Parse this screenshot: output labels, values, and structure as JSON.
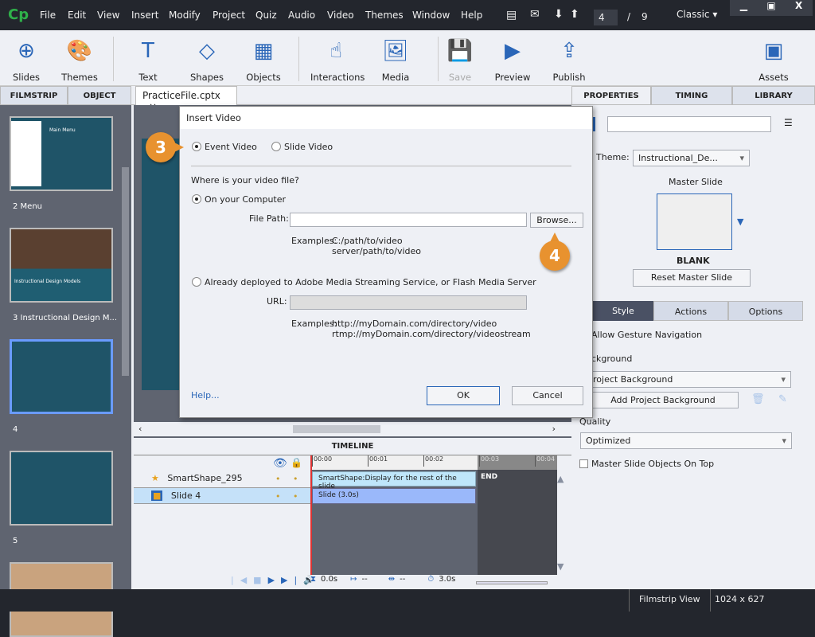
{
  "app": {
    "logo": "Cp",
    "menu": [
      "File",
      "Edit",
      "View",
      "Insert",
      "Modify",
      "Project",
      "Quiz",
      "Audio",
      "Video",
      "Themes",
      "Window",
      "Help"
    ],
    "current_slide": "4",
    "slide_sep": "/",
    "total_slides": "9",
    "workspace": "Classic"
  },
  "toolbar": {
    "items": [
      {
        "label": "Slides",
        "icon": "plus-circle-icon"
      },
      {
        "label": "Themes",
        "icon": "palette-icon"
      },
      {
        "label": "Text",
        "icon": "text-icon"
      },
      {
        "label": "Shapes",
        "icon": "shapes-icon"
      },
      {
        "label": "Objects",
        "icon": "objects-icon"
      },
      {
        "label": "Interactions",
        "icon": "hand-pointer-icon"
      },
      {
        "label": "Media",
        "icon": "image-icon"
      },
      {
        "label": "Save",
        "icon": "floppy-icon"
      },
      {
        "label": "Preview",
        "icon": "play-circle-icon"
      },
      {
        "label": "Publish",
        "icon": "publish-icon"
      },
      {
        "label": "Assets",
        "icon": "assets-icon"
      }
    ]
  },
  "panels": {
    "filmstrip": "FILMSTRIP",
    "object_state": "OBJECT STATE",
    "doc_tab": "PracticeFile.cptx",
    "properties": "PROPERTIES",
    "timing": "TIMING",
    "library": "LIBRARY"
  },
  "filmstrip": {
    "slides": [
      {
        "label": "2 Menu",
        "title": "Main Menu"
      },
      {
        "label": "3 Instructional Design M...",
        "title": "Instructional Design Models"
      },
      {
        "label": "4"
      },
      {
        "label": "5"
      }
    ]
  },
  "dialog": {
    "title": "Insert Video",
    "event_video": "Event Video",
    "slide_video": "Slide Video",
    "question": "Where is your video file?",
    "on_computer": "On your Computer",
    "file_path_label": "File Path:",
    "file_path_value": "",
    "browse": "Browse...",
    "examples_label": "Examples:",
    "file_ex1": "C:/path/to/video",
    "file_ex2": "server/path/to/video",
    "deployed": "Already deployed to Adobe Media Streaming Service, or Flash Media Server",
    "url_label": "URL:",
    "url_ex1": "http://myDomain.com/directory/video",
    "url_ex2": "rtmp://myDomain.com/directory/videostream",
    "help": "Help...",
    "ok": "OK",
    "cancel": "Cancel"
  },
  "callouts": {
    "step3": "3",
    "step4": "4"
  },
  "timeline": {
    "title": "TIMELINE",
    "ticks": [
      "00:00",
      "00:01",
      "00:02",
      "00:03",
      "00:04"
    ],
    "rows": [
      {
        "name": "SmartShape_295",
        "bar": "SmartShape:Display for the rest of the slide"
      },
      {
        "name": "Slide 4",
        "bar": "Slide (3.0s)"
      }
    ],
    "end": "END",
    "start_time": "0.0s",
    "in": "--",
    "dur": "--",
    "total": "3.0s"
  },
  "properties": {
    "theme_label": "Theme:",
    "theme_value": "Instructional_De...",
    "master_slide": "Master Slide",
    "master_name": "BLANK",
    "reset": "Reset Master Slide",
    "tabs": [
      "Style",
      "Actions",
      "Options"
    ],
    "gesture": "Allow Gesture Navigation",
    "background_label": "ckground",
    "background_value": "roject Background",
    "add_bg": "Add Project Background",
    "quality_label": "Quality",
    "quality_value": "Optimized",
    "master_on_top": "Master Slide Objects On Top"
  },
  "status": {
    "view": "Filmstrip View",
    "size": "1024 x 627"
  },
  "colors": {
    "accent": "#2a66b8",
    "callout": "#e8922f",
    "slide": "#1f5468"
  }
}
